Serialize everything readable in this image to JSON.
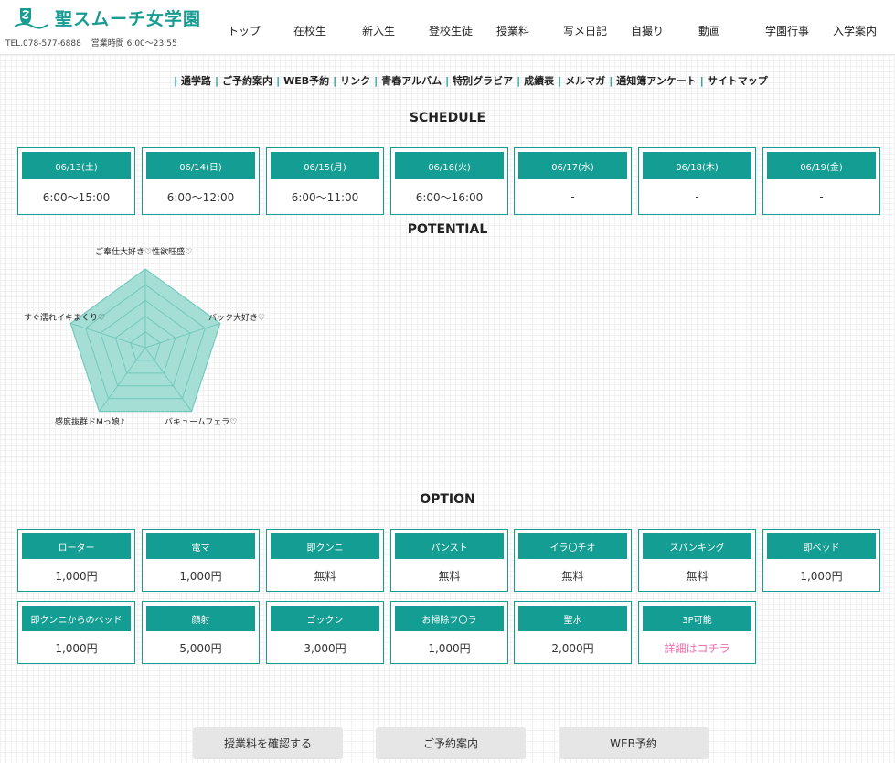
{
  "header": {
    "logo_text": "聖スムーチ女学園",
    "tel": "TEL.078-577-6888",
    "hours": "営業時間 6:00〜23:55",
    "nav": [
      "トップ",
      "在校生",
      "新入生",
      "登校生徒",
      "授業料",
      "写メ日記",
      "自撮り",
      "動画",
      "学園行事",
      "入学案内"
    ]
  },
  "subnav": [
    "通学路",
    "ご予約案内",
    "WEB予約",
    "リンク",
    "青春アルバム",
    "特別グラビア",
    "成績表",
    "メルマガ",
    "通知簿アンケート",
    "サイトマップ"
  ],
  "schedule": {
    "title": "SCHEDULE",
    "days": [
      {
        "date": "06/13(土)",
        "time": "6:00〜15:00"
      },
      {
        "date": "06/14(日)",
        "time": "6:00〜12:00"
      },
      {
        "date": "06/15(月)",
        "time": "6:00〜11:00"
      },
      {
        "date": "06/16(火)",
        "time": "6:00〜16:00"
      },
      {
        "date": "06/17(水)",
        "time": "-"
      },
      {
        "date": "06/18(木)",
        "time": "-"
      },
      {
        "date": "06/19(金)",
        "time": "-"
      }
    ]
  },
  "potential": {
    "title": "POTENTIAL",
    "axes": [
      "ご奉仕大好き♡性欲旺盛♡",
      "バック大好き♡",
      "バキュームフェラ♡",
      "感度抜群ドMっ娘♪",
      "すぐ濡れイキまくり♡"
    ],
    "values": [
      5,
      5,
      5,
      5,
      5
    ],
    "max": 5,
    "fill_color": "#a5ded5",
    "line_color": "#73c9bc"
  },
  "option": {
    "title": "OPTION",
    "items": [
      {
        "name": "ローター",
        "price": "1,000円"
      },
      {
        "name": "電マ",
        "price": "1,000円"
      },
      {
        "name": "即クンニ",
        "price": "無料"
      },
      {
        "name": "パンスト",
        "price": "無料"
      },
      {
        "name": "イラ〇チオ",
        "price": "無料"
      },
      {
        "name": "スパンキング",
        "price": "無料"
      },
      {
        "name": "即ベッド",
        "price": "1,000円"
      },
      {
        "name": "即クンニからのベッド",
        "price": "1,000円"
      },
      {
        "name": "顔射",
        "price": "5,000円"
      },
      {
        "name": "ゴックン",
        "price": "3,000円"
      },
      {
        "name": "お掃除フ〇ラ",
        "price": "1,000円"
      },
      {
        "name": "聖水",
        "price": "2,000円"
      },
      {
        "name": "3P可能",
        "price": "詳細はコチラ",
        "link": true
      }
    ]
  },
  "buttons": [
    "授業料を確認する",
    "ご予約案内",
    "WEB予約"
  ],
  "colors": {
    "accent": "#149d92",
    "link_pink": "#ee6fae",
    "button_bg": "#e6e6e6"
  }
}
